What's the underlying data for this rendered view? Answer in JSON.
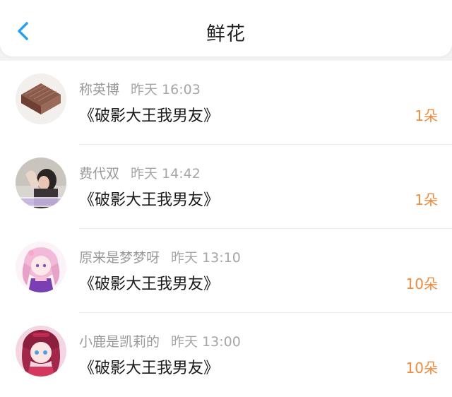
{
  "header": {
    "title": "鲜花",
    "back_icon": "chevron-left-icon",
    "accent_color": "#2a9df4"
  },
  "count_color": "#f08a3c",
  "gifts": [
    {
      "user": "称英博",
      "time": "昨天 16:03",
      "work": "《破影大王我男友》",
      "count": "1朵",
      "avatar": "brown-tile-avatar"
    },
    {
      "user": "费代双",
      "time": "昨天 14:42",
      "work": "《破影大王我男友》",
      "count": "1朵",
      "avatar": "girl-photo-avatar"
    },
    {
      "user": "原来是梦梦呀",
      "time": "昨天 13:10",
      "work": "《破影大王我男友》",
      "count": "10朵",
      "avatar": "anime-pink-avatar"
    },
    {
      "user": "小鹿是凯莉的",
      "time": "昨天 13:00",
      "work": "《破影大王我男友》",
      "count": "10朵",
      "avatar": "anime-red-avatar"
    }
  ]
}
